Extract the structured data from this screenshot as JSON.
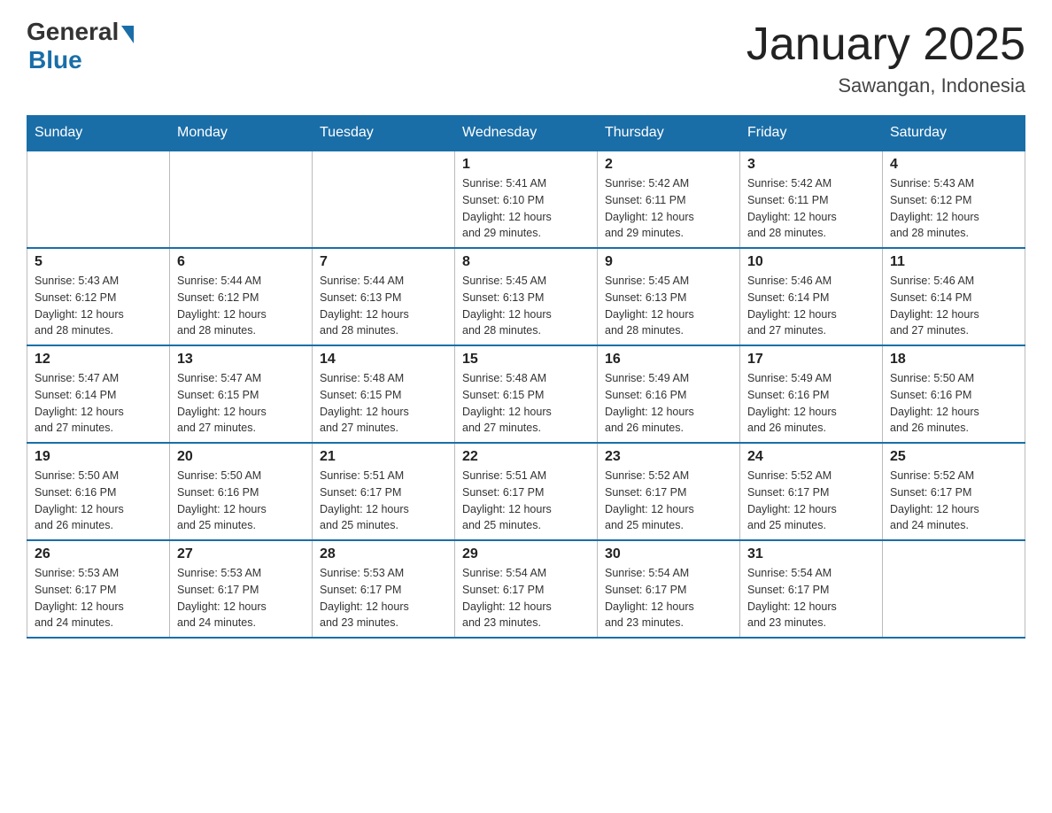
{
  "header": {
    "logo_general": "General",
    "logo_blue": "Blue",
    "month_title": "January 2025",
    "location": "Sawangan, Indonesia"
  },
  "days_of_week": [
    "Sunday",
    "Monday",
    "Tuesday",
    "Wednesday",
    "Thursday",
    "Friday",
    "Saturday"
  ],
  "weeks": [
    [
      {
        "day": "",
        "info": ""
      },
      {
        "day": "",
        "info": ""
      },
      {
        "day": "",
        "info": ""
      },
      {
        "day": "1",
        "info": "Sunrise: 5:41 AM\nSunset: 6:10 PM\nDaylight: 12 hours\nand 29 minutes."
      },
      {
        "day": "2",
        "info": "Sunrise: 5:42 AM\nSunset: 6:11 PM\nDaylight: 12 hours\nand 29 minutes."
      },
      {
        "day": "3",
        "info": "Sunrise: 5:42 AM\nSunset: 6:11 PM\nDaylight: 12 hours\nand 28 minutes."
      },
      {
        "day": "4",
        "info": "Sunrise: 5:43 AM\nSunset: 6:12 PM\nDaylight: 12 hours\nand 28 minutes."
      }
    ],
    [
      {
        "day": "5",
        "info": "Sunrise: 5:43 AM\nSunset: 6:12 PM\nDaylight: 12 hours\nand 28 minutes."
      },
      {
        "day": "6",
        "info": "Sunrise: 5:44 AM\nSunset: 6:12 PM\nDaylight: 12 hours\nand 28 minutes."
      },
      {
        "day": "7",
        "info": "Sunrise: 5:44 AM\nSunset: 6:13 PM\nDaylight: 12 hours\nand 28 minutes."
      },
      {
        "day": "8",
        "info": "Sunrise: 5:45 AM\nSunset: 6:13 PM\nDaylight: 12 hours\nand 28 minutes."
      },
      {
        "day": "9",
        "info": "Sunrise: 5:45 AM\nSunset: 6:13 PM\nDaylight: 12 hours\nand 28 minutes."
      },
      {
        "day": "10",
        "info": "Sunrise: 5:46 AM\nSunset: 6:14 PM\nDaylight: 12 hours\nand 27 minutes."
      },
      {
        "day": "11",
        "info": "Sunrise: 5:46 AM\nSunset: 6:14 PM\nDaylight: 12 hours\nand 27 minutes."
      }
    ],
    [
      {
        "day": "12",
        "info": "Sunrise: 5:47 AM\nSunset: 6:14 PM\nDaylight: 12 hours\nand 27 minutes."
      },
      {
        "day": "13",
        "info": "Sunrise: 5:47 AM\nSunset: 6:15 PM\nDaylight: 12 hours\nand 27 minutes."
      },
      {
        "day": "14",
        "info": "Sunrise: 5:48 AM\nSunset: 6:15 PM\nDaylight: 12 hours\nand 27 minutes."
      },
      {
        "day": "15",
        "info": "Sunrise: 5:48 AM\nSunset: 6:15 PM\nDaylight: 12 hours\nand 27 minutes."
      },
      {
        "day": "16",
        "info": "Sunrise: 5:49 AM\nSunset: 6:16 PM\nDaylight: 12 hours\nand 26 minutes."
      },
      {
        "day": "17",
        "info": "Sunrise: 5:49 AM\nSunset: 6:16 PM\nDaylight: 12 hours\nand 26 minutes."
      },
      {
        "day": "18",
        "info": "Sunrise: 5:50 AM\nSunset: 6:16 PM\nDaylight: 12 hours\nand 26 minutes."
      }
    ],
    [
      {
        "day": "19",
        "info": "Sunrise: 5:50 AM\nSunset: 6:16 PM\nDaylight: 12 hours\nand 26 minutes."
      },
      {
        "day": "20",
        "info": "Sunrise: 5:50 AM\nSunset: 6:16 PM\nDaylight: 12 hours\nand 25 minutes."
      },
      {
        "day": "21",
        "info": "Sunrise: 5:51 AM\nSunset: 6:17 PM\nDaylight: 12 hours\nand 25 minutes."
      },
      {
        "day": "22",
        "info": "Sunrise: 5:51 AM\nSunset: 6:17 PM\nDaylight: 12 hours\nand 25 minutes."
      },
      {
        "day": "23",
        "info": "Sunrise: 5:52 AM\nSunset: 6:17 PM\nDaylight: 12 hours\nand 25 minutes."
      },
      {
        "day": "24",
        "info": "Sunrise: 5:52 AM\nSunset: 6:17 PM\nDaylight: 12 hours\nand 25 minutes."
      },
      {
        "day": "25",
        "info": "Sunrise: 5:52 AM\nSunset: 6:17 PM\nDaylight: 12 hours\nand 24 minutes."
      }
    ],
    [
      {
        "day": "26",
        "info": "Sunrise: 5:53 AM\nSunset: 6:17 PM\nDaylight: 12 hours\nand 24 minutes."
      },
      {
        "day": "27",
        "info": "Sunrise: 5:53 AM\nSunset: 6:17 PM\nDaylight: 12 hours\nand 24 minutes."
      },
      {
        "day": "28",
        "info": "Sunrise: 5:53 AM\nSunset: 6:17 PM\nDaylight: 12 hours\nand 23 minutes."
      },
      {
        "day": "29",
        "info": "Sunrise: 5:54 AM\nSunset: 6:17 PM\nDaylight: 12 hours\nand 23 minutes."
      },
      {
        "day": "30",
        "info": "Sunrise: 5:54 AM\nSunset: 6:17 PM\nDaylight: 12 hours\nand 23 minutes."
      },
      {
        "day": "31",
        "info": "Sunrise: 5:54 AM\nSunset: 6:17 PM\nDaylight: 12 hours\nand 23 minutes."
      },
      {
        "day": "",
        "info": ""
      }
    ]
  ]
}
